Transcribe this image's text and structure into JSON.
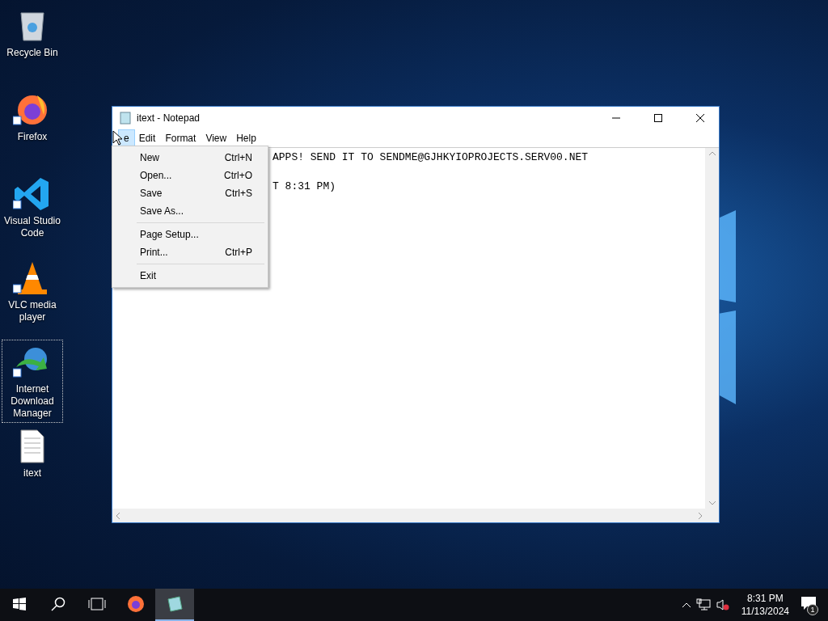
{
  "desktop_icons": [
    {
      "label": "Recycle Bin",
      "kind": "bin",
      "shortcut": false,
      "selected": false
    },
    {
      "label": "Firefox",
      "kind": "firefox",
      "shortcut": true,
      "selected": false
    },
    {
      "label": "Visual Studio Code",
      "kind": "vscode",
      "shortcut": true,
      "selected": false
    },
    {
      "label": "VLC media player",
      "kind": "vlc",
      "shortcut": true,
      "selected": false
    },
    {
      "label": "Internet Download Manager",
      "kind": "idm",
      "shortcut": true,
      "selected": true
    },
    {
      "label": "itext",
      "kind": "file",
      "shortcut": false,
      "selected": false
    }
  ],
  "window": {
    "title": "itext - Notepad"
  },
  "menu_bar": [
    {
      "label": "e",
      "selected": true
    },
    {
      "label": "Edit",
      "selected": false
    },
    {
      "label": "Format",
      "selected": false
    },
    {
      "label": "View",
      "selected": false
    },
    {
      "label": "Help",
      "selected": false
    }
  ],
  "editor": {
    "lines": [
      "APPS! SEND IT TO SENDME@GJHKYIOPROJECTS.SERV00.NET",
      "T 8:31 PM)"
    ]
  },
  "file_menu": [
    {
      "kind": "item",
      "label": "New",
      "shortcut": "Ctrl+N"
    },
    {
      "kind": "item",
      "label": "Open...",
      "shortcut": "Ctrl+O"
    },
    {
      "kind": "item",
      "label": "Save",
      "shortcut": "Ctrl+S"
    },
    {
      "kind": "item",
      "label": "Save As..."
    },
    {
      "kind": "separator"
    },
    {
      "kind": "item",
      "label": "Page Setup..."
    },
    {
      "kind": "item",
      "label": "Print...",
      "shortcut": "Ctrl+P"
    },
    {
      "kind": "separator"
    },
    {
      "kind": "item",
      "label": "Exit"
    }
  ],
  "taskbar": {
    "apps": [
      {
        "kind": "start"
      },
      {
        "kind": "search"
      },
      {
        "kind": "taskview"
      },
      {
        "kind": "firefox",
        "selected": false
      },
      {
        "kind": "notepad",
        "selected": true
      }
    ],
    "time": "8:31 PM",
    "date": "11/13/2024",
    "notifications": "1"
  }
}
